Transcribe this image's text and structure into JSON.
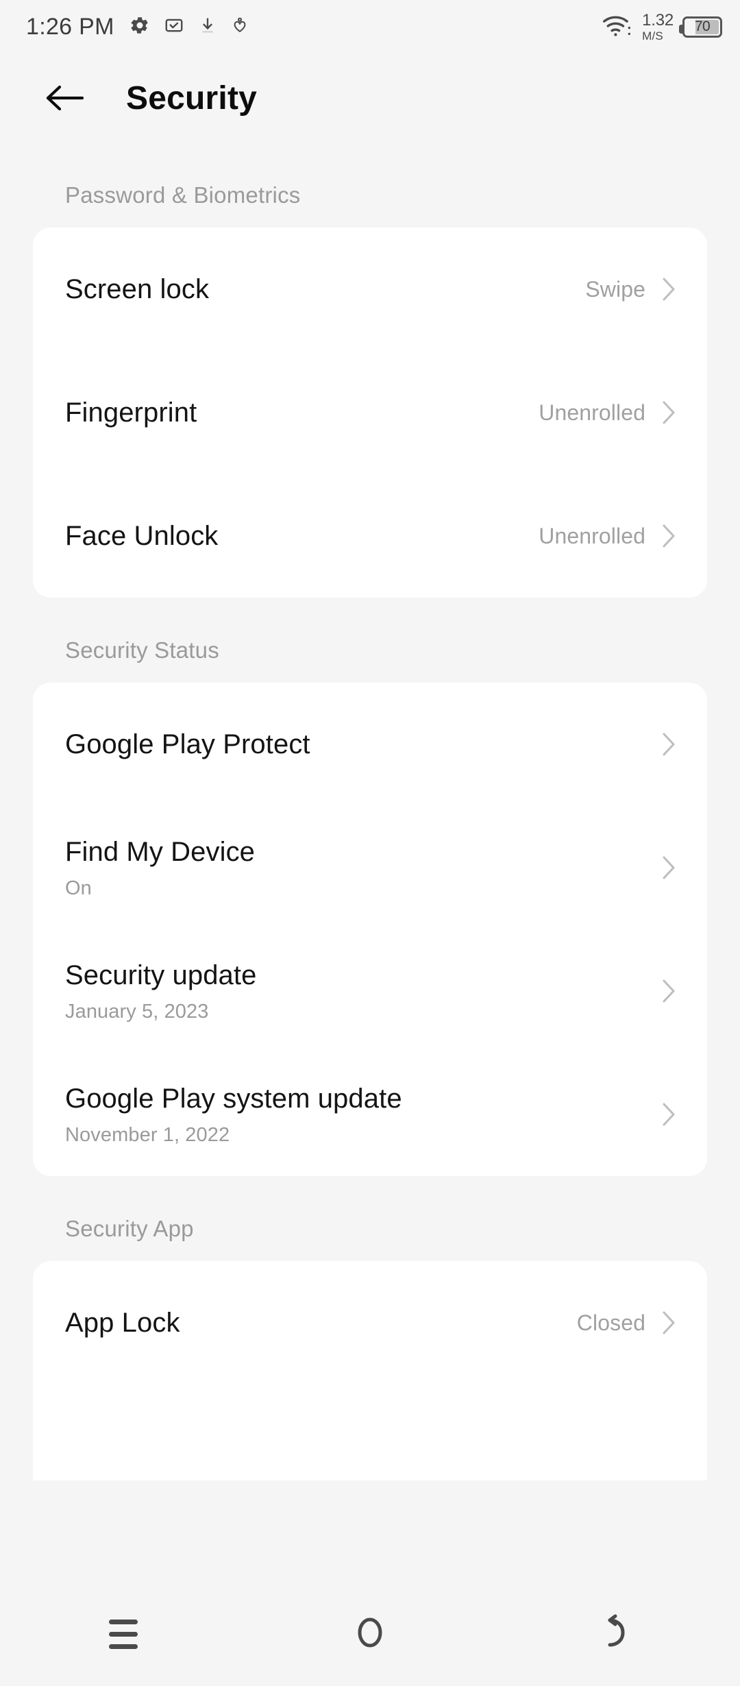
{
  "statusbar": {
    "time": "1:26 PM",
    "icons": [
      "gear-icon",
      "mail-check-icon",
      "download-icon",
      "heart-health-icon"
    ],
    "network_speed_value": "1.32",
    "network_speed_unit": "M/S",
    "battery_level": "70",
    "wifi": "wifi-icon"
  },
  "header": {
    "title": "Security",
    "back": "back-arrow-icon"
  },
  "sections": [
    {
      "label": "Password & Biometrics",
      "items": [
        {
          "title": "Screen lock",
          "sub": "",
          "value": "Swipe"
        },
        {
          "title": "Fingerprint",
          "sub": "",
          "value": "Unenrolled"
        },
        {
          "title": "Face Unlock",
          "sub": "",
          "value": "Unenrolled"
        }
      ]
    },
    {
      "label": "Security Status",
      "items": [
        {
          "title": "Google Play Protect",
          "sub": "",
          "value": ""
        },
        {
          "title": "Find My Device",
          "sub": "On",
          "value": ""
        },
        {
          "title": "Security update",
          "sub": "January 5, 2023",
          "value": ""
        },
        {
          "title": "Google Play system update",
          "sub": "November 1, 2022",
          "value": ""
        }
      ]
    },
    {
      "label": "Security App",
      "items": [
        {
          "title": "App Lock",
          "sub": "",
          "value": "Closed"
        }
      ]
    }
  ],
  "navbar": {
    "recents": "menu-icon",
    "home": "home-circle-icon",
    "back": "back-curved-icon"
  },
  "colors": {
    "background": "#f5f5f5",
    "card": "#ffffff",
    "title_text": "#141414",
    "secondary_text": "#9a9a9a",
    "nav_icon": "#4a4a4a"
  }
}
